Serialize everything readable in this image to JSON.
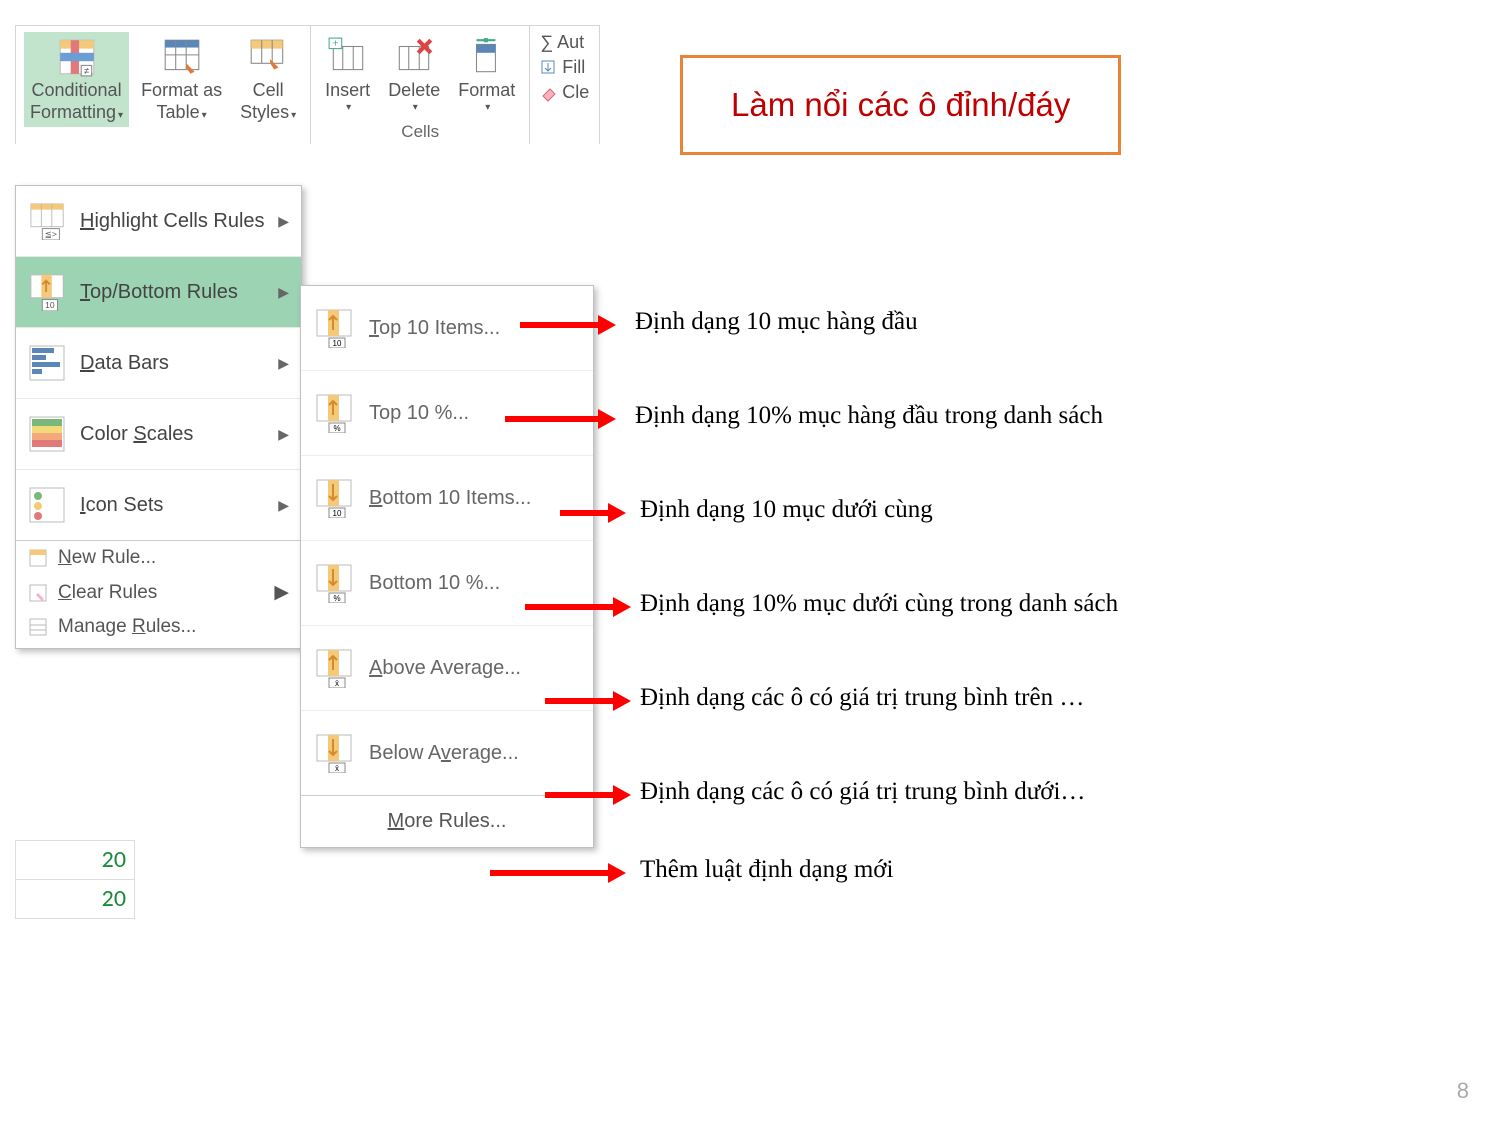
{
  "ribbon": {
    "styles": {
      "cf": "Conditional",
      "cf2": "Formatting",
      "fmt": "Format as",
      "fmt2": "Table",
      "cs": "Cell",
      "cs2": "Styles"
    },
    "cells": {
      "ins": "Insert",
      "del": "Delete",
      "fmt": "Format",
      "label": "Cells"
    },
    "edit": {
      "sum": "∑ Aut",
      "fill": "Fill",
      "clear": "Cle"
    }
  },
  "cfmenu": {
    "hcr": "Highlight Cells Rules",
    "tbr": "Top/Bottom Rules",
    "db": "Data Bars",
    "cs": "Color Scales",
    "is": "Icon Sets",
    "new": "New Rule...",
    "clear": "Clear Rules",
    "manage": "Manage Rules..."
  },
  "submenu": {
    "t10i": "Top 10 Items...",
    "t10p": "Top 10 %...",
    "b10i": "Bottom 10 Items...",
    "b10p": "Bottom 10 %...",
    "above": "Above Average...",
    "below": "Below Average...",
    "more": "More Rules..."
  },
  "title": "Làm nổi các ô đỉnh/đáy",
  "anno": {
    "a1": "Định dạng 10 mục hàng đầu",
    "a2": "Định dạng 10% mục hàng đầu trong danh sách",
    "a3": "Định dạng 10 mục dưới cùng",
    "a4": "Định dạng 10% mục dưới cùng trong danh sách",
    "a5": "Định dạng các ô có giá trị trung bình trên …",
    "a6": "Định dạng các ô có giá trị trung bình dưới…",
    "a7": "Thêm luật định dạng mới"
  },
  "cells": {
    "c1": "20",
    "c2": "20"
  },
  "pagenum": "8"
}
